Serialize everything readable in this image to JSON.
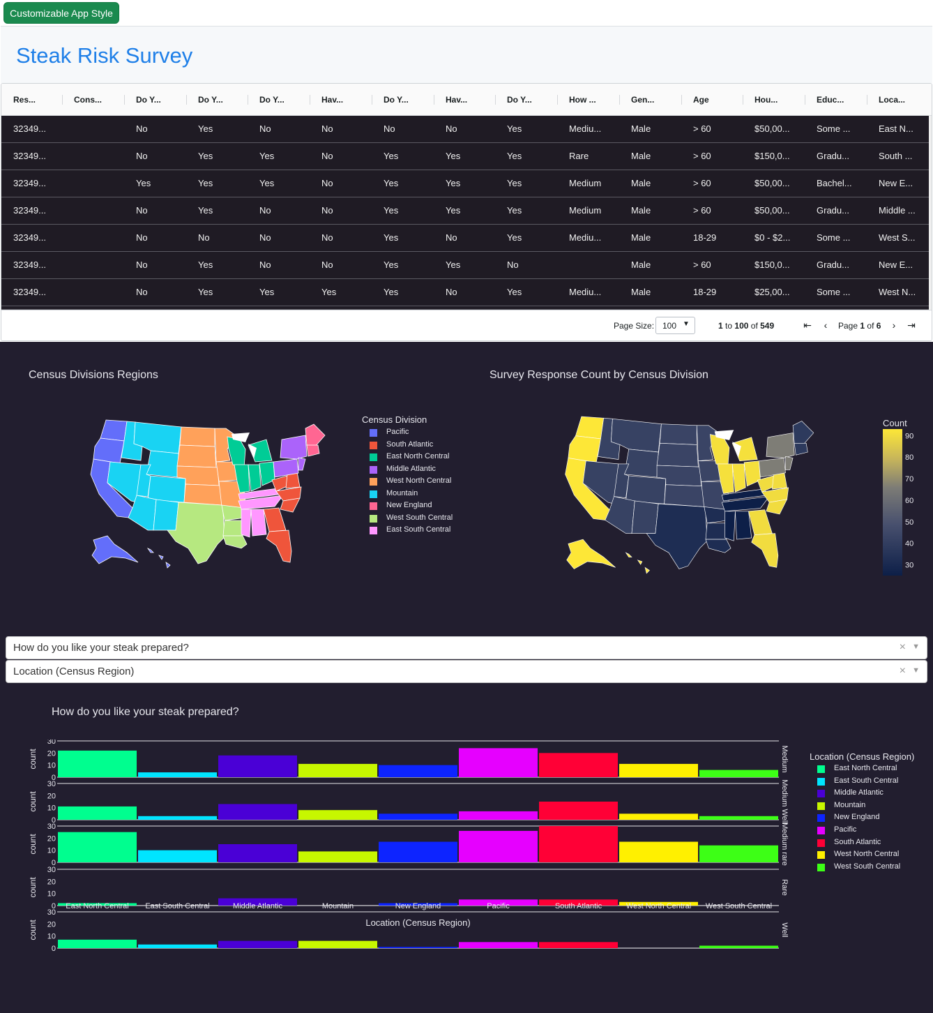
{
  "app_style_button": "Customizable App Style",
  "title": "Steak Risk Survey",
  "grid": {
    "headers": [
      "Res...",
      "Cons...",
      "Do Y...",
      "Do Y...",
      "Do Y...",
      "Hav...",
      "Do Y...",
      "Hav...",
      "Do Y...",
      "How ...",
      "Gen...",
      "Age",
      "Hou...",
      "Educ...",
      "Loca..."
    ],
    "rows": [
      [
        "32349...",
        "",
        "No",
        "Yes",
        "No",
        "No",
        "No",
        "No",
        "Yes",
        "Mediu...",
        "Male",
        "> 60",
        "$50,00...",
        "Some ...",
        "East N..."
      ],
      [
        "32349...",
        "",
        "No",
        "Yes",
        "Yes",
        "No",
        "Yes",
        "Yes",
        "Yes",
        "Rare",
        "Male",
        "> 60",
        "$150,0...",
        "Gradu...",
        "South ..."
      ],
      [
        "32349...",
        "",
        "Yes",
        "Yes",
        "Yes",
        "No",
        "Yes",
        "Yes",
        "Yes",
        "Medium",
        "Male",
        "> 60",
        "$50,00...",
        "Bachel...",
        "New E..."
      ],
      [
        "32349...",
        "",
        "No",
        "Yes",
        "No",
        "No",
        "Yes",
        "Yes",
        "Yes",
        "Medium",
        "Male",
        "> 60",
        "$50,00...",
        "Gradu...",
        "Middle ..."
      ],
      [
        "32349...",
        "",
        "No",
        "No",
        "No",
        "No",
        "Yes",
        "No",
        "Yes",
        "Mediu...",
        "Male",
        "18-29",
        "$0 - $2...",
        "Some ...",
        "West S..."
      ],
      [
        "32349...",
        "",
        "No",
        "Yes",
        "No",
        "No",
        "Yes",
        "Yes",
        "No",
        "",
        "Male",
        "> 60",
        "$150,0...",
        "Gradu...",
        "New E..."
      ],
      [
        "32349...",
        "",
        "No",
        "Yes",
        "Yes",
        "Yes",
        "Yes",
        "No",
        "Yes",
        "Mediu...",
        "Male",
        "18-29",
        "$25,00...",
        "Some ...",
        "West N..."
      ]
    ],
    "pager": {
      "page_size_label": "Page Size:",
      "page_size": "100",
      "range_from": "1",
      "range_to_word": "to",
      "range_to": "100",
      "of_word": "of",
      "total": "549",
      "page_word": "Page",
      "page": "1",
      "page_total": "6"
    }
  },
  "map1": {
    "title": "Census Divisions Regions",
    "legend_title": "Census Division",
    "legend": [
      {
        "name": "Pacific",
        "color": "#636efa"
      },
      {
        "name": "South Atlantic",
        "color": "#ef553b"
      },
      {
        "name": "East North Central",
        "color": "#00cc96"
      },
      {
        "name": "Middle Atlantic",
        "color": "#ab63fa"
      },
      {
        "name": "West North Central",
        "color": "#ffa15a"
      },
      {
        "name": "Mountain",
        "color": "#19d3f3"
      },
      {
        "name": "New England",
        "color": "#ff6692"
      },
      {
        "name": "West South Central",
        "color": "#b6e880"
      },
      {
        "name": "East South Central",
        "color": "#ff97ff"
      }
    ]
  },
  "map2": {
    "title": "Survey Response Count by Census Division",
    "colorbar_title": "Count",
    "colorbar_ticks": [
      90,
      80,
      70,
      60,
      50,
      40,
      30
    ],
    "colorbar_range": [
      25,
      93
    ]
  },
  "dropdowns": [
    {
      "value": "How do you like your steak prepared?",
      "clear": "×",
      "caret": "▼"
    },
    {
      "value": "Location (Census Region)",
      "clear": "×",
      "caret": "▼"
    }
  ],
  "chart_data": {
    "type": "bar",
    "title": "How do you like your steak prepared?",
    "xlabel": "Location (Census Region)",
    "ylabel": "count",
    "ylim": [
      0,
      30
    ],
    "yticks": [
      0,
      10,
      20,
      30
    ],
    "categories": [
      "East North Central",
      "East South Central",
      "Middle Atlantic",
      "Mountain",
      "New England",
      "Pacific",
      "South Atlantic",
      "West North Central",
      "West South Central"
    ],
    "colors": [
      "#00fe8f",
      "#00e5ff",
      "#4a00d6",
      "#c7f700",
      "#0d24ff",
      "#e600ff",
      "#ff0036",
      "#fff000",
      "#3dff16"
    ],
    "legend_title": "Location (Census Region)",
    "facets": [
      {
        "label": "Medium",
        "values": [
          22,
          4,
          18,
          11,
          10,
          24,
          20,
          11,
          6
        ]
      },
      {
        "label": "Medium Well",
        "values": [
          11,
          3,
          13,
          8,
          5,
          7,
          15,
          5,
          3
        ]
      },
      {
        "label": "Medium rare",
        "values": [
          25,
          10,
          15,
          9,
          17,
          26,
          30,
          17,
          14
        ]
      },
      {
        "label": "Rare",
        "values": [
          2,
          0,
          6,
          0,
          2,
          5,
          5,
          3,
          0
        ]
      },
      {
        "label": "Well",
        "values": [
          7,
          3,
          6,
          6,
          1,
          5,
          5,
          0,
          2
        ]
      }
    ]
  }
}
